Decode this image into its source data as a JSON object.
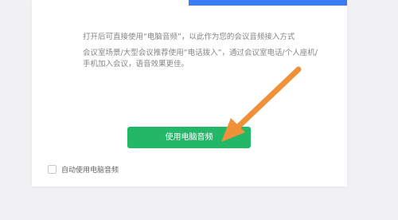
{
  "dialog": {
    "description_1": "打开后可直接使用“电脑音频”，以此作为您的会议音频接入方式",
    "description_2": "会议室场景/大型会议推荐使用“电话拨入”，通过会议室电话/个人座机/手机加入会议，语音效果更佳。",
    "use_computer_audio_button": "使用电脑音频",
    "auto_use_label": "自动使用电脑音频"
  },
  "colors": {
    "tab_accent": "#3a7cf5",
    "primary_button": "#22b868",
    "annotation_arrow": "#f0913a"
  }
}
